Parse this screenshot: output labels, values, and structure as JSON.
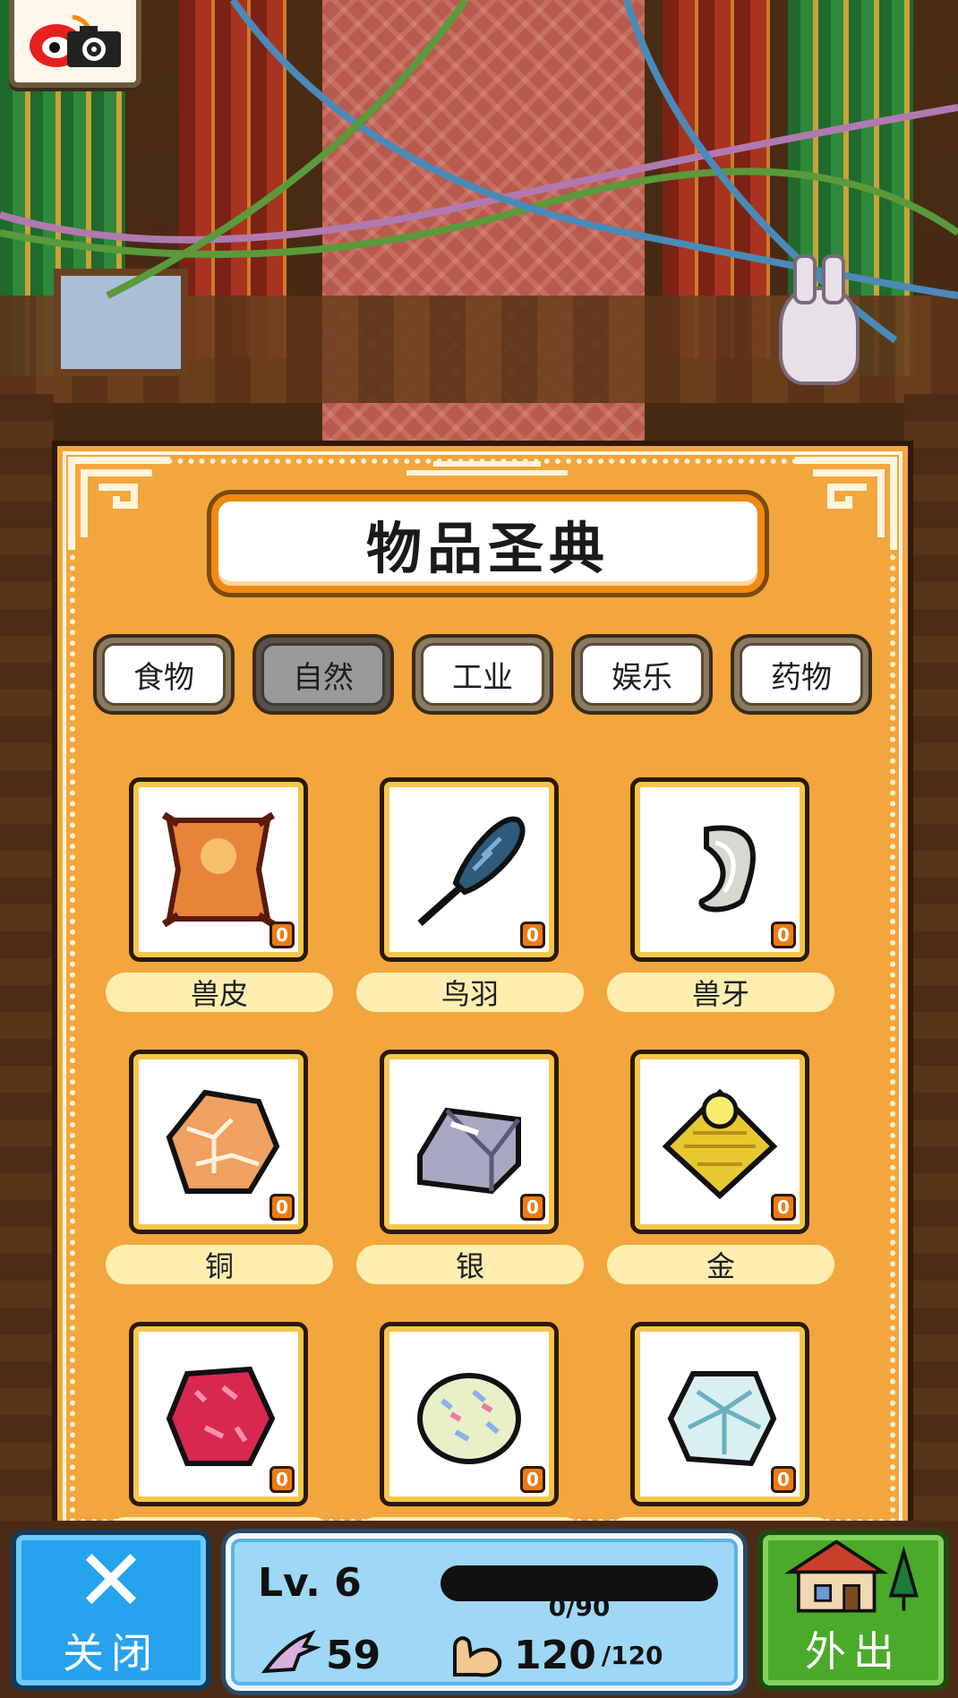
{
  "book": {
    "title": "物品圣典"
  },
  "tabs": [
    {
      "label": "食物",
      "active": false
    },
    {
      "label": "自然",
      "active": true
    },
    {
      "label": "工业",
      "active": false
    },
    {
      "label": "娱乐",
      "active": false
    },
    {
      "label": "药物",
      "active": false
    }
  ],
  "items": [
    {
      "name": "兽皮",
      "count": "0",
      "icon": "hide-icon"
    },
    {
      "name": "鸟羽",
      "count": "0",
      "icon": "feather-icon"
    },
    {
      "name": "兽牙",
      "count": "0",
      "icon": "fang-icon"
    },
    {
      "name": "铜",
      "count": "0",
      "icon": "copper-ore-icon"
    },
    {
      "name": "银",
      "count": "0",
      "icon": "silver-ingot-icon"
    },
    {
      "name": "金",
      "count": "0",
      "icon": "gold-pile-icon"
    },
    {
      "name": "",
      "count": "0",
      "icon": "red-gem-icon"
    },
    {
      "name": "",
      "count": "0",
      "icon": "opal-gem-icon"
    },
    {
      "name": "",
      "count": "0",
      "icon": "crystal-gem-icon"
    }
  ],
  "hud": {
    "close_label": "关闭",
    "go_out_label": "外出",
    "level": "Lv. 6",
    "xp_text": "0/90",
    "xp_fraction": 0,
    "bird_count": "59",
    "stamina_current": "120",
    "stamina_max": "/120"
  },
  "colors": {
    "panel": "#f3a63e",
    "title_border": "#f08a12",
    "close_button": "#26a2ee",
    "go_button": "#4aaa2a",
    "count_badge": "#f07a10"
  }
}
